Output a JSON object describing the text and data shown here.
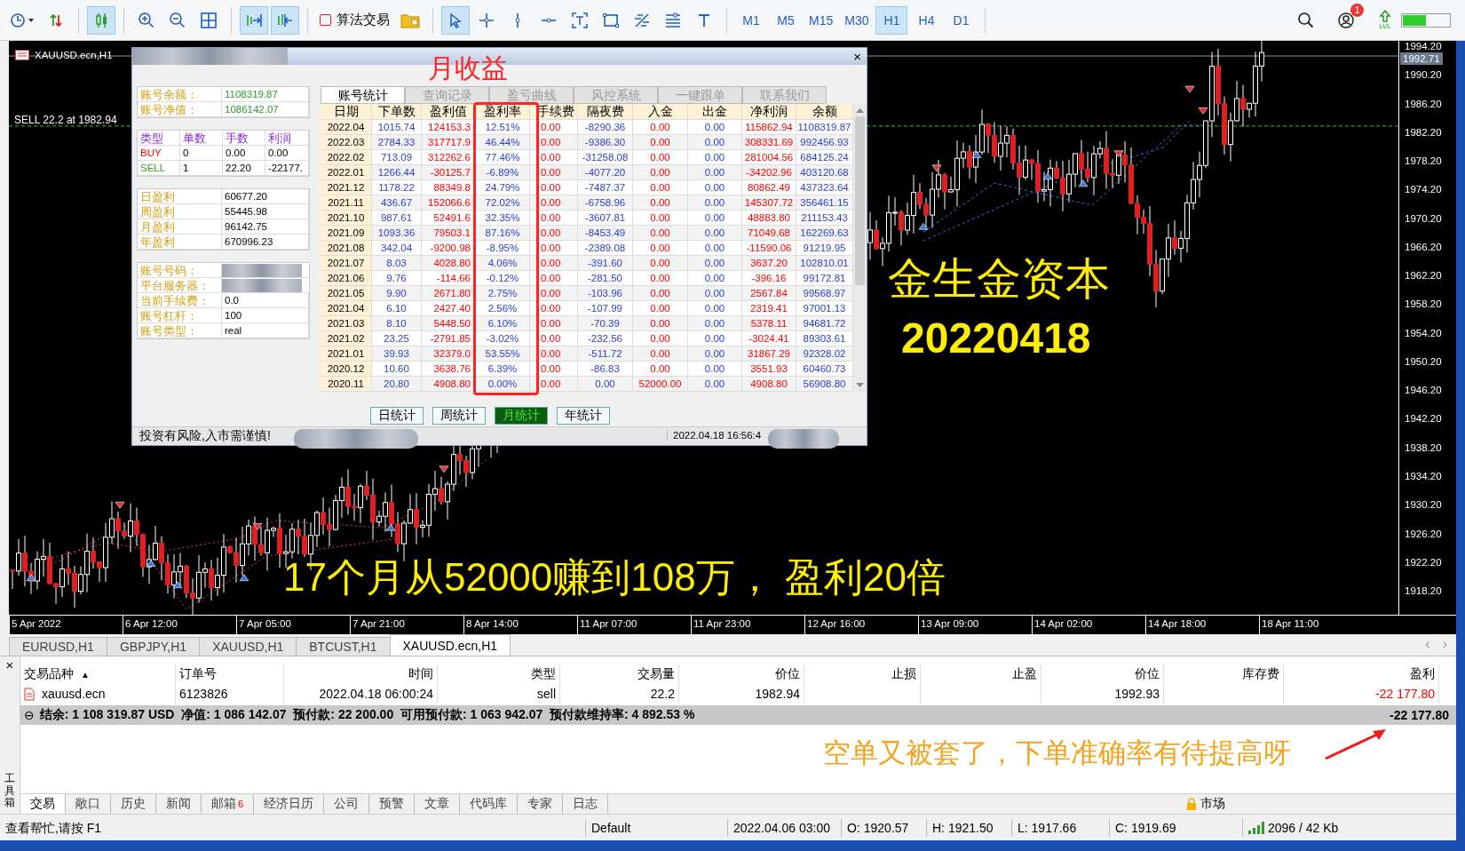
{
  "toolbar": {
    "buttons": [
      {
        "selected": false
      },
      {
        "selected": false
      },
      {
        "selected": true
      },
      {
        "selected": false
      },
      {
        "selected": false
      },
      {
        "selected": false
      },
      {
        "selected": true
      },
      {
        "selected": true
      }
    ],
    "algo_trading": "算法交易",
    "tools": [
      {
        "selected": true
      },
      {
        "selected": false
      },
      {
        "selected": false
      },
      {
        "selected": false
      },
      {
        "selected": false
      },
      {
        "selected": false
      },
      {
        "selected": false
      },
      {
        "selected": false
      },
      {
        "selected": false
      }
    ],
    "timeframes": [
      {
        "label": "M1",
        "selected": false
      },
      {
        "label": "M5",
        "selected": false
      },
      {
        "label": "M15",
        "selected": false
      },
      {
        "label": "M30",
        "selected": false
      },
      {
        "label": "H1",
        "selected": true
      },
      {
        "label": "H4",
        "selected": false
      },
      {
        "label": "D1",
        "selected": false
      }
    ],
    "notification_count": "1",
    "lvl_label": "LVL"
  },
  "chart": {
    "title": "XAUUSD.ecn,H1",
    "order_line_label": "SELL 22.2 at 1982.94",
    "current_price": "1992.71",
    "price_ticks": [
      "1994.20",
      "1990.20",
      "1986.20",
      "1982.20",
      "1978.20",
      "1974.20",
      "1970.20",
      "1966.20",
      "1962.20",
      "1958.20",
      "1954.20",
      "1950.20",
      "1946.20",
      "1942.20",
      "1938.20",
      "1934.20",
      "1930.20",
      "1926.20",
      "1922.20",
      "1918.20"
    ],
    "time_labels": [
      "5 Apr 2022",
      "6 Apr 12:00",
      "7 Apr 05:00",
      "7 Apr 21:00",
      "8 Apr 14:00",
      "11 Apr 07:00",
      "11 Apr 23:00",
      "12 Apr 16:00",
      "13 Apr 09:00",
      "14 Apr 02:00",
      "14 Apr 18:00",
      "18 Apr 11:00"
    ]
  },
  "dialog": {
    "close_glyph": "×",
    "balance": [
      {
        "label": "账号余额：",
        "value": "1108319.87"
      },
      {
        "label": "账号净值：",
        "value": "1086142.07"
      }
    ],
    "positions": {
      "columns": [
        "类型",
        "单数",
        "手数",
        "利润"
      ],
      "rows": [
        {
          "kind": "buy",
          "type": "BUY",
          "count": "0",
          "lots": "0.00",
          "profit": "0.00"
        },
        {
          "kind": "sell",
          "type": "SELL",
          "count": "1",
          "lots": "22.20",
          "profit": "-22177."
        }
      ]
    },
    "profits": [
      {
        "label": "日盈利",
        "value": "60677.20"
      },
      {
        "label": "周盈利",
        "value": "55445.98"
      },
      {
        "label": "月盈利",
        "value": "96142.75"
      },
      {
        "label": "年盈利",
        "value": "670996.23"
      }
    ],
    "account": [
      {
        "label": "账号号码："
      },
      {
        "label": "平台服务器："
      },
      {
        "label": "当前手续费：",
        "value": "0.0"
      },
      {
        "label": "账号杠杆：",
        "value": "100"
      },
      {
        "label": "账号类型：",
        "value": "real"
      }
    ],
    "tabs": [
      {
        "label": "账号统计",
        "selected": true
      },
      {
        "label": "查询记录",
        "selected": false
      },
      {
        "label": "盈亏曲线",
        "selected": false
      },
      {
        "label": "风控系统",
        "selected": false
      },
      {
        "label": "一键跟单",
        "selected": false
      },
      {
        "label": "联系我们",
        "selected": false
      }
    ],
    "columns": [
      "日期",
      "下单数",
      "盈利值",
      "盈利率",
      "手续费",
      "隔夜费",
      "入金",
      "出金",
      "净利润",
      "余额"
    ],
    "rows": [
      [
        "2022.04",
        "1015.74",
        "124153.3",
        "12.51%",
        "0.00",
        "-8290.36",
        "0.00",
        "0.00",
        "115862.94",
        "1108319.87"
      ],
      [
        "2022.03",
        "2784.33",
        "317717.9",
        "46.44%",
        "0.00",
        "-9386.30",
        "0.00",
        "0.00",
        "308331.69",
        "992456.93"
      ],
      [
        "2022.02",
        "713.09",
        "312262.6",
        "77.46%",
        "0.00",
        "-31258.08",
        "0.00",
        "0.00",
        "281004.56",
        "684125.24"
      ],
      [
        "2022.01",
        "1266.44",
        "-30125.7",
        "-6.89%",
        "0.00",
        "-4077.20",
        "0.00",
        "0.00",
        "-34202.96",
        "403120.68"
      ],
      [
        "2021.12",
        "1178.22",
        "88349.8",
        "24.79%",
        "0.00",
        "-7487.37",
        "0.00",
        "0.00",
        "80862.49",
        "437323.64"
      ],
      [
        "2021.11",
        "436.67",
        "152066.6",
        "72.02%",
        "0.00",
        "-6758.96",
        "0.00",
        "0.00",
        "145307.72",
        "356461.15"
      ],
      [
        "2021.10",
        "987.61",
        "52491.6",
        "32.35%",
        "0.00",
        "-3607.81",
        "0.00",
        "0.00",
        "48883.80",
        "211153.43"
      ],
      [
        "2021.09",
        "1093.36",
        "79503.1",
        "87.16%",
        "0.00",
        "-8453.49",
        "0.00",
        "0.00",
        "71049.68",
        "162269.63"
      ],
      [
        "2021.08",
        "342.04",
        "-9200.98",
        "-8.95%",
        "0.00",
        "-2389.08",
        "0.00",
        "0.00",
        "-11590.06",
        "91219.95"
      ],
      [
        "2021.07",
        "8.03",
        "4028.80",
        "4.06%",
        "0.00",
        "-391.60",
        "0.00",
        "0.00",
        "3637.20",
        "102810.01"
      ],
      [
        "2021.06",
        "9.76",
        "-114.66",
        "-0.12%",
        "0.00",
        "-281.50",
        "0.00",
        "0.00",
        "-396.16",
        "99172.81"
      ],
      [
        "2021.05",
        "9.90",
        "2671.80",
        "2.75%",
        "0.00",
        "-103.96",
        "0.00",
        "0.00",
        "2567.84",
        "99568.97"
      ],
      [
        "2021.04",
        "6.10",
        "2427.40",
        "2.56%",
        "0.00",
        "-107.99",
        "0.00",
        "0.00",
        "2319.41",
        "97001.13"
      ],
      [
        "2021.03",
        "8.10",
        "5448.50",
        "6.10%",
        "0.00",
        "-70.39",
        "0.00",
        "0.00",
        "5378.11",
        "94681.72"
      ],
      [
        "2021.02",
        "23.25",
        "-2791.85",
        "-3.02%",
        "0.00",
        "-232.56",
        "0.00",
        "0.00",
        "-3024.41",
        "89303.61"
      ],
      [
        "2021.01",
        "39.93",
        "32379.0",
        "53.55%",
        "0.00",
        "-511.72",
        "0.00",
        "0.00",
        "31867.29",
        "92328.02"
      ],
      [
        "2020.12",
        "10.60",
        "3638.76",
        "6.39%",
        "0.00",
        "-86.83",
        "0.00",
        "0.00",
        "3551.93",
        "60460.73"
      ],
      [
        "2020.11",
        "20.80",
        "4908.80",
        "0.00%",
        "0.00",
        "0.00",
        "52000.00",
        "0.00",
        "4908.80",
        "56908.80"
      ]
    ],
    "period_buttons": [
      {
        "label": "日统计",
        "selected": false
      },
      {
        "label": "周统计",
        "selected": false
      },
      {
        "label": "月统计",
        "selected": true
      },
      {
        "label": "年统计",
        "selected": false
      }
    ],
    "footer_notice": "投资有风险,入市需谨慎!",
    "footer_time": "2022.04.18 16:56:4"
  },
  "annotations": {
    "column_highlight_label": "月收益",
    "brand_lines": [
      "金生金资本",
      "20220418"
    ],
    "headline": "17个月从52000赚到108万， 盈利20倍",
    "comment": "空单又被套了，下单准确率有待提高呀"
  },
  "chart_tabs": {
    "tabs": [
      {
        "label": "EURUSD,H1",
        "selected": false
      },
      {
        "label": "GBPJPY,H1",
        "selected": false
      },
      {
        "label": "XAUUSD,H1",
        "selected": false
      },
      {
        "label": "BTCUST,H1",
        "selected": false
      },
      {
        "label": "XAUUSD.ecn,H1",
        "selected": true
      }
    ],
    "scroll_glyphs": [
      "‹",
      "›"
    ]
  },
  "terminal": {
    "close_glyph": "×",
    "side_label": "工具箱",
    "sort_glyph": "▲",
    "columns": [
      "交易品种",
      "订单号",
      "时间",
      "类型",
      "交易量",
      "价位",
      "止损",
      "止盈",
      "价位",
      "库存费",
      "盈利"
    ],
    "rows": [
      [
        "xauusd.ecn",
        "6123826",
        "2022.04.18 06:00:24",
        "sell",
        "22.2",
        "1982.94",
        null,
        null,
        "1992.93",
        null,
        "-22 177.80"
      ]
    ],
    "summary": {
      "collapse_glyph": "⊖",
      "text": "结余: 1 108 319.87 USD  净值: 1 086 142.07  预付款: 22 200.00  可用预付款: 1 063 942.07  预付款维持率: 4 892.53 %",
      "total": "-22 177.80"
    },
    "tabs": [
      {
        "label": "交易",
        "selected": true
      },
      {
        "label": "敞口",
        "selected": false
      },
      {
        "label": "历史",
        "selected": false
      },
      {
        "label": "新闻",
        "selected": false
      },
      {
        "label": "邮箱",
        "selected": false,
        "badge": "6"
      },
      {
        "label": "经济日历",
        "selected": false
      },
      {
        "label": "公司",
        "selected": false
      },
      {
        "label": "预警",
        "selected": false
      },
      {
        "label": "文章",
        "selected": false
      },
      {
        "label": "代码库",
        "selected": false
      },
      {
        "label": "专家",
        "selected": false
      },
      {
        "label": "日志",
        "selected": false
      }
    ],
    "market_label": "市场"
  },
  "status_bar": {
    "help": "查看帮忙,请按 F1",
    "profile": "Default",
    "time": "2022.04.06 03:00",
    "open": "O: 1920.57",
    "high": "H: 1921.50",
    "low": "L: 1917.66",
    "close": "C: 1919.69",
    "traffic": "2096 / 42 Kb"
  }
}
